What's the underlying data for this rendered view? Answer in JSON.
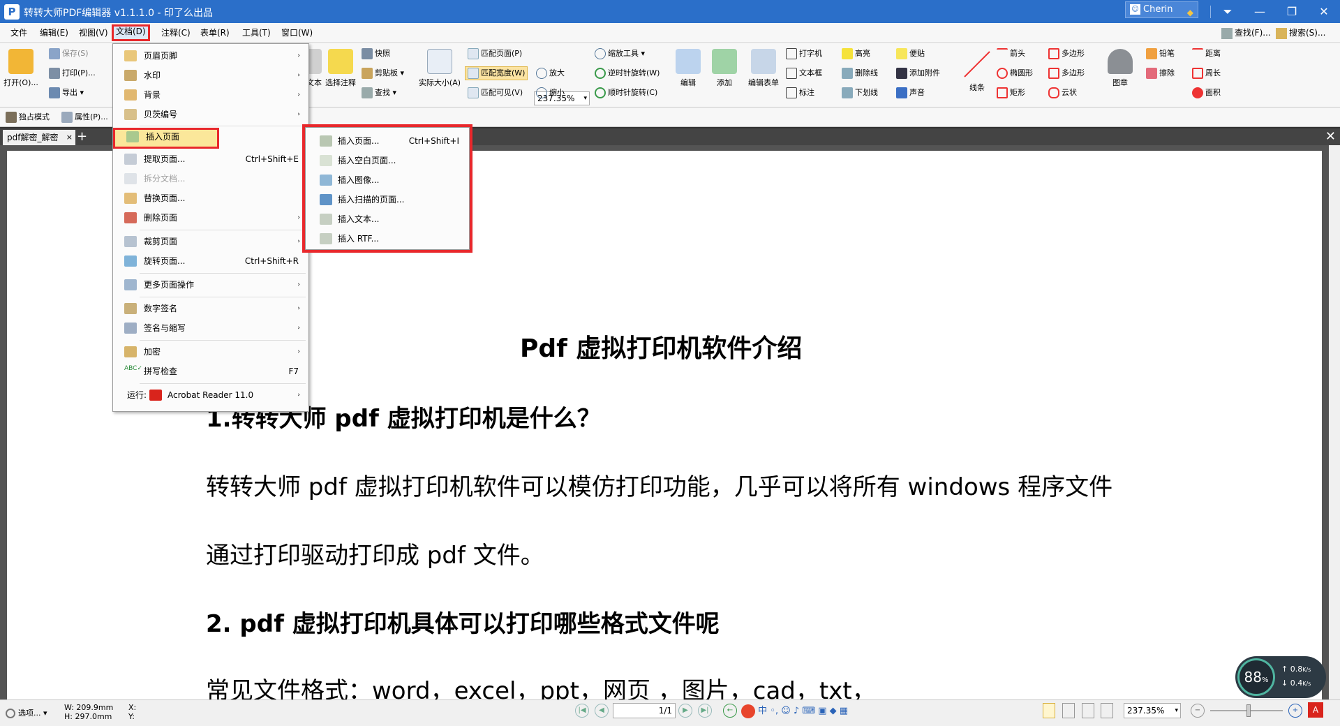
{
  "window": {
    "title": "转转大师PDF编辑器 v1.1.1.0 - 印了么出品",
    "app_icon": "P",
    "user": "Cherin"
  },
  "menubar": {
    "items": [
      "文件",
      "编辑(E)",
      "视图(V)",
      "文档(D)",
      "注释(C)",
      "表单(R)",
      "工具(T)",
      "窗口(W)"
    ],
    "find": "查找(F)...",
    "search": "搜索(S)..."
  },
  "ribbon": {
    "open": "打开(O)...",
    "save": "保存(S)",
    "print": "打印(P)...",
    "export": "导出",
    "exclusive": "独占模式",
    "properties": "属性(P)...",
    "text": "文本",
    "select_annot": "选择注释",
    "snapshot": "快照",
    "clipboard": "剪贴板",
    "find": "查找",
    "actual_size": "实际大小(A)",
    "fit_page": "匹配页面(P)",
    "fit_width": "匹配宽度(W)",
    "fit_visible": "匹配可见(V)",
    "zoom_value": "237.35%",
    "zoom_tool": "缩放工具",
    "zoom_in": "放大",
    "zoom_out": "缩小",
    "rotate_ccw": "逆时针旋转(W)",
    "rotate_cw": "顺时针旋转(C)",
    "edit": "编辑",
    "add": "添加",
    "edit_form": "编辑表单",
    "typewriter": "打字机",
    "textbox": "文本框",
    "callout": "标注",
    "highlight": "高亮",
    "strikeout": "删除线",
    "underline": "下划线",
    "note": "便贴",
    "attach": "添加附件",
    "sound": "声音",
    "lines": "线条",
    "arrow": "箭头",
    "ellipse": "椭圆形",
    "rect": "矩形",
    "polygon": "多边形",
    "polyline": "多边形",
    "cloud": "云状",
    "stamp": "图章",
    "pencil": "铅笔",
    "eraser": "擦除",
    "distance": "距离",
    "perimeter": "周长",
    "area": "面积"
  },
  "doc_menu": {
    "items": [
      {
        "label": "页眉页脚",
        "arrow": "›"
      },
      {
        "label": "水印",
        "arrow": "›"
      },
      {
        "label": "背景",
        "arrow": "›"
      },
      {
        "label": "贝茨编号",
        "arrow": "›"
      },
      {
        "label": "插入页面",
        "arrow": "›"
      },
      {
        "label": "提取页面...",
        "shortcut": "Ctrl+Shift+E"
      },
      {
        "label": "拆分文档..."
      },
      {
        "label": "替换页面..."
      },
      {
        "label": "删除页面",
        "arrow": "›"
      },
      {
        "label": "裁剪页面",
        "arrow": "›"
      },
      {
        "label": "旋转页面...",
        "shortcut": "Ctrl+Shift+R"
      },
      {
        "label": "更多页面操作",
        "arrow": "›"
      },
      {
        "label": "数字签名",
        "arrow": "›"
      },
      {
        "label": "签名与缩写",
        "arrow": "›"
      },
      {
        "label": "加密",
        "arrow": "›"
      },
      {
        "label": "拼写检查",
        "shortcut": "F7"
      },
      {
        "label": "Acrobat Reader 11.0",
        "prefix": "运行:",
        "arrow": "›"
      }
    ]
  },
  "insert_submenu": {
    "items": [
      {
        "label": "插入页面...",
        "shortcut": "Ctrl+Shift+I"
      },
      {
        "label": "插入空白页面..."
      },
      {
        "label": "插入图像..."
      },
      {
        "label": "插入扫描的页面..."
      },
      {
        "label": "插入文本..."
      },
      {
        "label": "插入 RTF..."
      }
    ]
  },
  "tabs": {
    "active": "pdf解密_解密",
    "close": "×",
    "add": "+"
  },
  "document": {
    "title": "Pdf 虚拟打印机软件介绍",
    "h1": "1.转转大师 pdf 虚拟打印机是什么？",
    "p1": "转转大师 pdf 虚拟打印机软件可以模仿打印功能，几乎可以将所有 windows 程序文件",
    "p2": "通过打印驱动打印成 pdf 文件。",
    "h2": "2.  pdf 虚拟打印机具体可以打印哪些格式文件呢",
    "p3": "常见文件格式：word，excel，ppt，网页  ，图片，cad，txt，"
  },
  "statusbar": {
    "options": "选项...",
    "width": "W: 209.9mm",
    "height": "H: 297.0mm",
    "x": "X:",
    "y": "Y:",
    "page": "1/1",
    "zoom": "237.35%"
  },
  "net_widget": {
    "percent": "88",
    "up": "0.8",
    "down": "0.4",
    "unit": "K/s"
  }
}
